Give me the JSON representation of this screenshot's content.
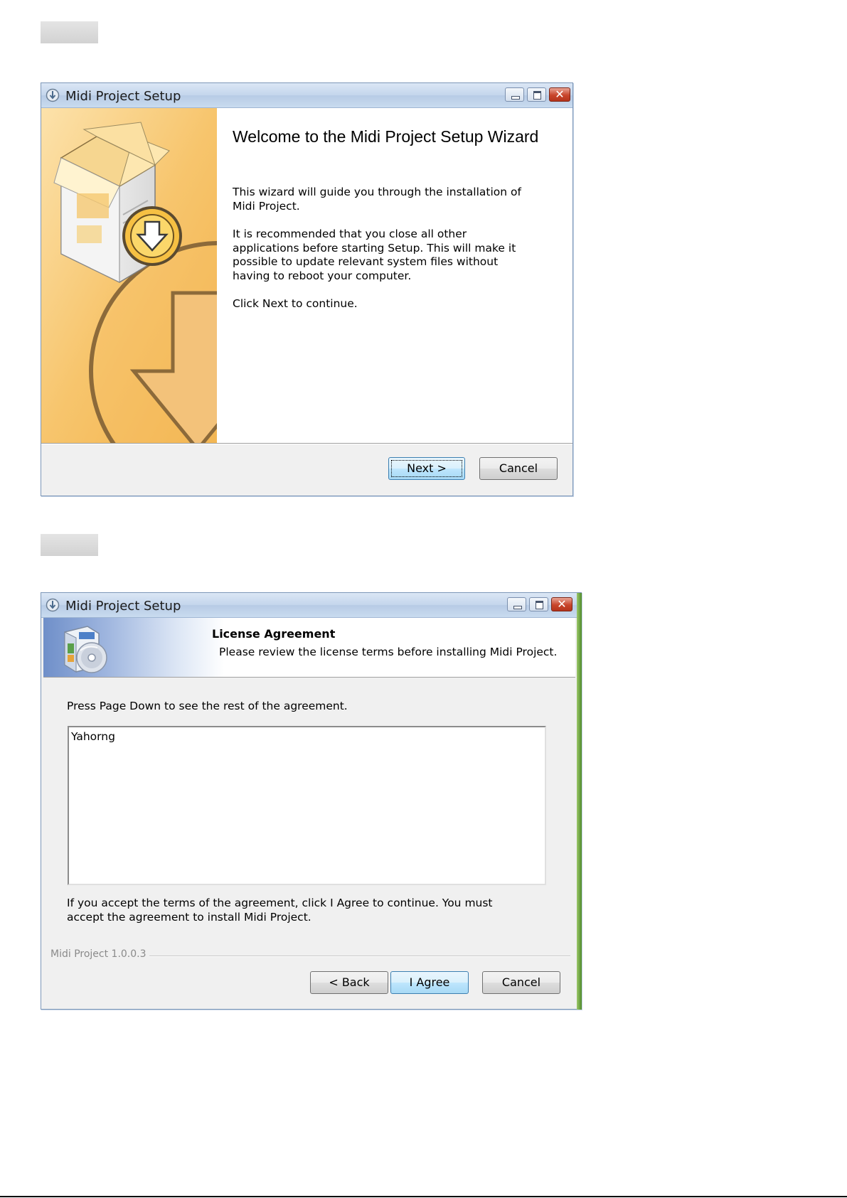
{
  "window1": {
    "title": "Midi Project Setup",
    "heading": "Welcome to the Midi Project Setup Wizard",
    "paragraph1": "This wizard will guide you through the installation of Midi Project.",
    "paragraph2": "It is recommended that you close all other applications before starting Setup. This will make it possible to update relevant system files without having to reboot your computer.",
    "paragraph3": "Click Next to continue.",
    "next_button": "Next >",
    "cancel_button": "Cancel"
  },
  "window2": {
    "title": "Midi Project Setup",
    "header_title": "License Agreement",
    "header_subtitle": "Please review the license terms before installing Midi Project.",
    "instruction": "Press Page Down to see the rest of the agreement.",
    "license_text": "Yahorng",
    "accept_text": "If you accept the terms of the agreement, click I Agree to continue. You must accept the agreement to install Midi Project.",
    "version_label": "Midi Project 1.0.0.3",
    "back_button": "< Back",
    "agree_button": "I Agree",
    "cancel_button": "Cancel"
  },
  "colors": {
    "titlebar": "#c4d6ec",
    "sidebar_orange": "#f7c56d",
    "default_button_border": "#3c7fb1"
  }
}
